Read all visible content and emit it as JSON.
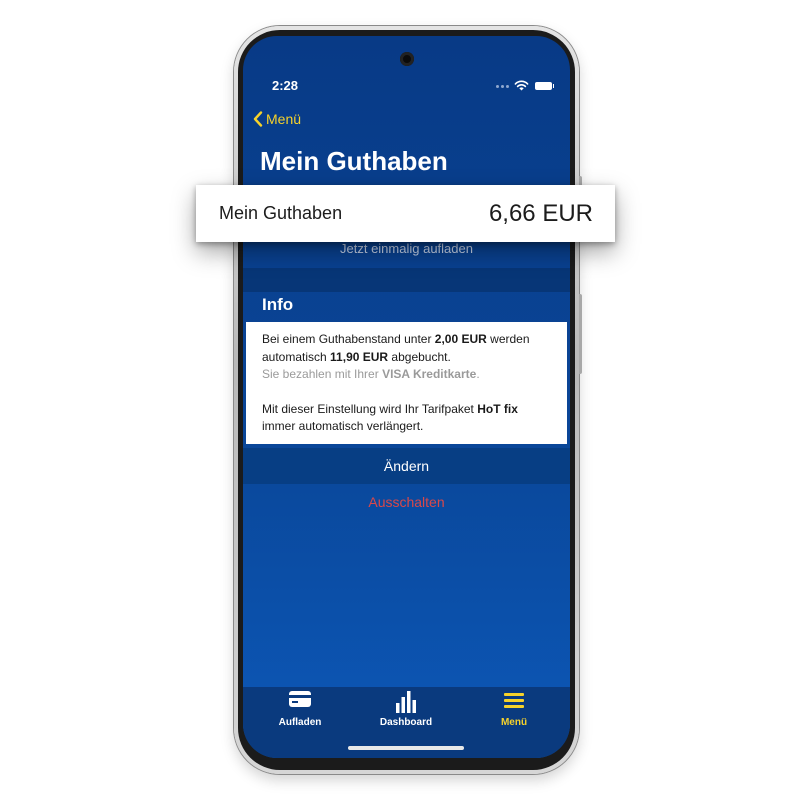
{
  "status_bar": {
    "time": "2:28"
  },
  "nav": {
    "back_label": "Menü",
    "title": "Mein Guthaben"
  },
  "balance": {
    "label": "Mein Guthaben",
    "value": "6,66 EUR"
  },
  "topup_once_label": "Jetzt einmalig aufladen",
  "info": {
    "title": "Info",
    "line1_pre": "Bei einem Guthabenstand unter ",
    "threshold": "2,00 EUR",
    "line1_post": " werden",
    "line2_pre": "automatisch ",
    "amount": "11,90 EUR",
    "line2_post": " abgebucht.",
    "payment_pre": "Sie bezahlen mit Ihrer ",
    "payment_method": "VISA Kreditkarte",
    "payment_post": ".",
    "tariff_pre": "Mit dieser Einstellung wird Ihr Tarifpaket ",
    "tariff_name": "HoT fix",
    "tariff_post": "immer automatisch verlängert."
  },
  "actions": {
    "change_label": "Ändern",
    "off_label": "Ausschalten"
  },
  "tabs": [
    {
      "label": "Aufladen",
      "icon": "credit-card-icon",
      "active": false
    },
    {
      "label": "Dashboard",
      "icon": "bar-chart-icon",
      "active": false
    },
    {
      "label": "Menü",
      "icon": "hamburger-menu-icon",
      "active": true
    }
  ],
  "colors": {
    "background_blue": "#0a4698",
    "accent_yellow": "#f6d22b",
    "danger_red": "#d9484a",
    "card_white": "#ffffff"
  }
}
